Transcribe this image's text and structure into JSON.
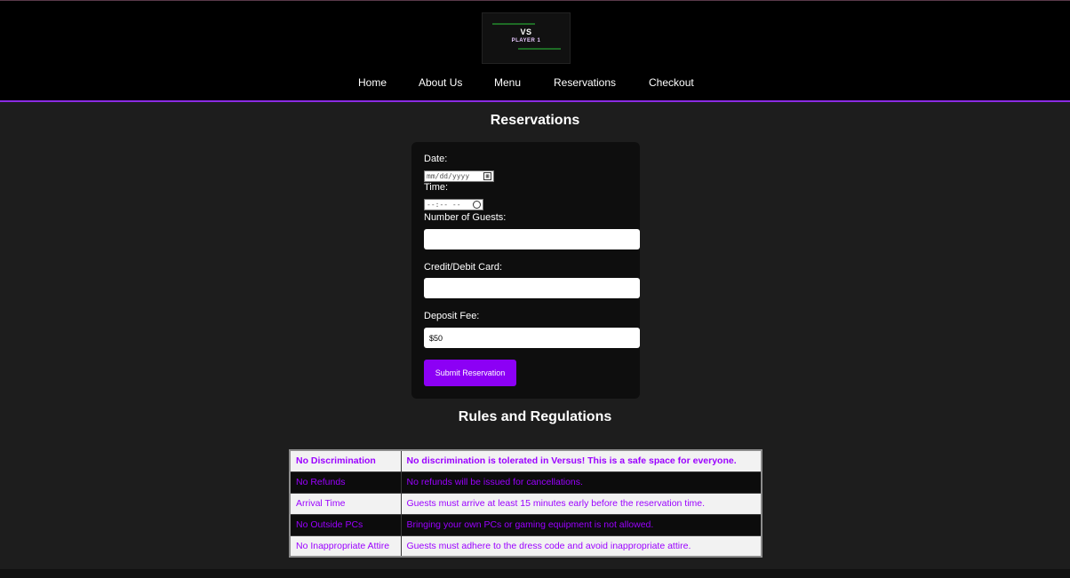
{
  "logo": {
    "top_text": "VS",
    "bottom_text": "PLAYER 1"
  },
  "nav": {
    "items": [
      "Home",
      "About Us",
      "Menu",
      "Reservations",
      "Checkout"
    ]
  },
  "reservations": {
    "title": "Reservations",
    "date_label": "Date:",
    "date_placeholder": "mm/dd/yyyy",
    "time_label": "Time:",
    "time_placeholder": "--:-- --",
    "guests_label": "Number of Guests:",
    "guests_value": "",
    "card_label": "Credit/Debit Card:",
    "card_value": "",
    "deposit_label": "Deposit Fee:",
    "deposit_value": "$50",
    "submit_label": "Submit Reservation"
  },
  "rules": {
    "title": "Rules and Regulations",
    "rows": [
      {
        "rule": "No Discrimination",
        "description": "No discrimination is tolerated in Versus! This is a safe space for everyone."
      },
      {
        "rule": "No Refunds",
        "description": "No refunds will be issued for cancellations."
      },
      {
        "rule": "Arrival Time",
        "description": "Guests must arrive at least 15 minutes early before the reservation time."
      },
      {
        "rule": "No Outside PCs",
        "description": "Bringing your own PCs or gaming equipment is not allowed."
      },
      {
        "rule": "No Inappropriate Attire",
        "description": "Guests must adhere to the dress code and avoid inappropriate attire."
      }
    ]
  },
  "colors": {
    "accent": "#8c00f5",
    "text_purple": "#9b00ff",
    "header_border": "#8a2be2"
  }
}
